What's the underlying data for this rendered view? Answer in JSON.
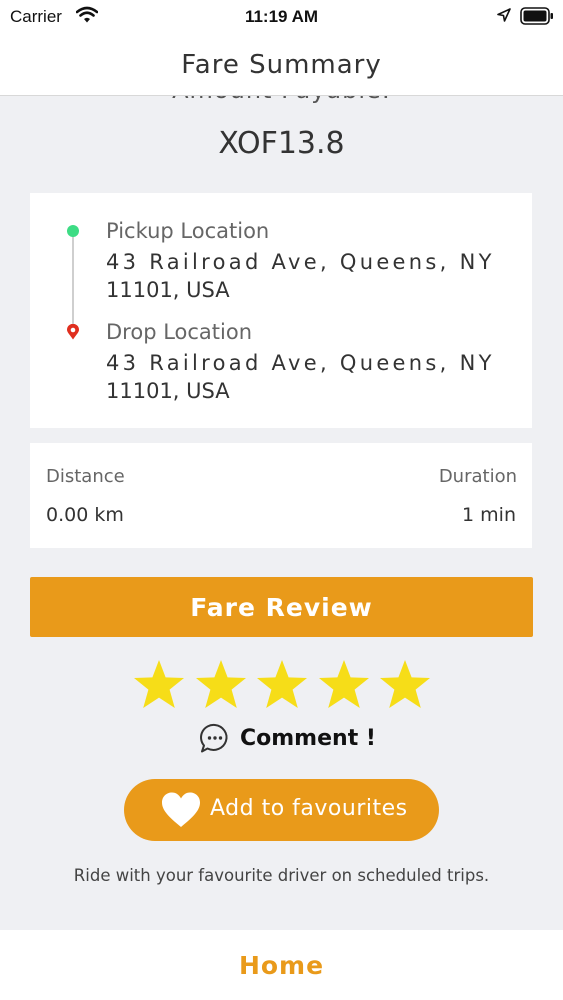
{
  "status_bar": {
    "carrier": "Carrier",
    "time": "11:19 AM"
  },
  "header": {
    "title": "Fare Summary"
  },
  "fare": {
    "amount_label": "Amount Payable:",
    "amount": "XOF13.8"
  },
  "route": {
    "pickup_label": "Pickup Location",
    "pickup_address_line1": "43 Railroad Ave, Queens, NY",
    "pickup_address_line2": "11101, USA",
    "drop_label": "Drop Location",
    "drop_address_line1": "43 Railroad Ave, Queens, NY",
    "drop_address_line2": "11101, USA",
    "pickup_color": "#3ddc84",
    "drop_color": "#e02f1f"
  },
  "metrics": {
    "distance_label": "Distance",
    "distance_value": "0.00 km",
    "duration_label": "Duration",
    "duration_value": "1 min"
  },
  "review": {
    "button_label": "Fare Review",
    "rating": 5,
    "rating_max": 5,
    "comment_label": "Comment !"
  },
  "favourite": {
    "button_label": "Add to favourites",
    "promo_text": "Ride with your favourite driver on scheduled trips."
  },
  "footer": {
    "home_label": "Home"
  },
  "colors": {
    "accent": "#e99a1a",
    "star": "#f6dd18",
    "background": "#eff0f3"
  },
  "icons": [
    "wifi-icon",
    "location-arrow-icon",
    "battery-icon",
    "star-icon",
    "chat-bubble-icon",
    "heart-icon",
    "map-pin-icon"
  ]
}
